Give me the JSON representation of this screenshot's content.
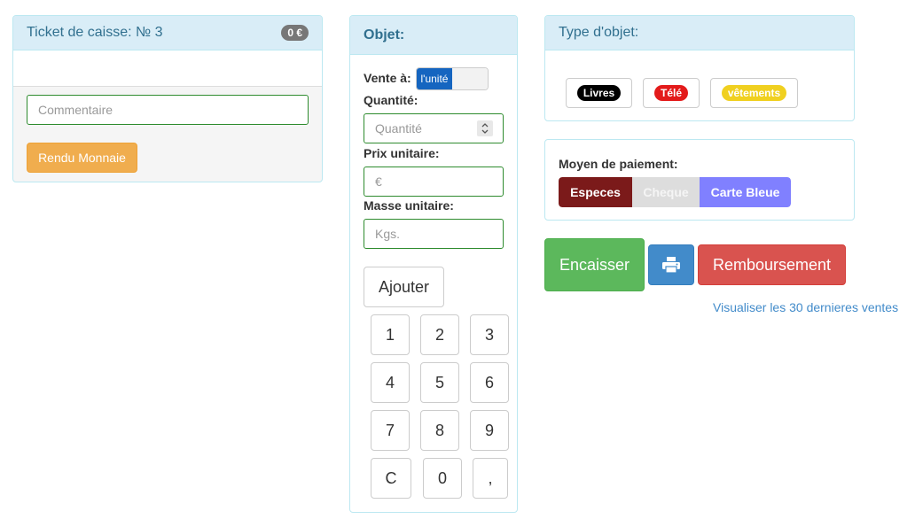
{
  "ticket": {
    "title": "Ticket de caisse: № 3",
    "total_badge": "0 €",
    "comment_placeholder": "Commentaire",
    "change_button": "Rendu Monnaie"
  },
  "objet": {
    "title": "Objet:",
    "sale_label": "Vente à:",
    "toggle_on_label": "l'unité",
    "quantity_label": "Quantité:",
    "quantity_placeholder": "Quantité",
    "unit_price_label": "Prix unitaire:",
    "unit_price_placeholder": "€",
    "unit_mass_label": "Masse unitaire:",
    "unit_mass_placeholder": "Kgs.",
    "add_button": "Ajouter",
    "keypad": [
      "1",
      "2",
      "3",
      "4",
      "5",
      "6",
      "7",
      "8",
      "9",
      "C",
      "0",
      ","
    ]
  },
  "type_objet": {
    "title": "Type d'objet:",
    "types": [
      {
        "label": "Livres",
        "color": "#000000",
        "text_color": "#ffffff"
      },
      {
        "label": "Télé",
        "color": "#e31b1b",
        "text_color": "#ffffff"
      },
      {
        "label": "vêtements",
        "color": "#f0d020",
        "text_color": "#ffffff"
      }
    ]
  },
  "payment": {
    "title": "Moyen de paiement:",
    "options": [
      {
        "label": "Especes",
        "color": "#7b1a1a",
        "text_color": "#ffffff",
        "state": "selected"
      },
      {
        "label": "Cheque",
        "color": "#dddddd",
        "text_color": "#f5f5f5",
        "state": "disabled"
      },
      {
        "label": "Carte Bleue",
        "color": "#8080ff",
        "text_color": "#ffffff",
        "state": "normal"
      }
    ]
  },
  "actions": {
    "cash_in": "Encaisser",
    "print_icon": "print-icon",
    "refund": "Remboursement",
    "history_link": "Visualiser les 30 dernieres ventes"
  },
  "colors": {
    "panel_heading_bg": "#d9edf7",
    "panel_heading_text": "#31708f",
    "warning": "#f0ad4e",
    "success": "#5cb85c",
    "primary": "#428bca",
    "danger": "#d9534f",
    "link": "#428bca"
  }
}
